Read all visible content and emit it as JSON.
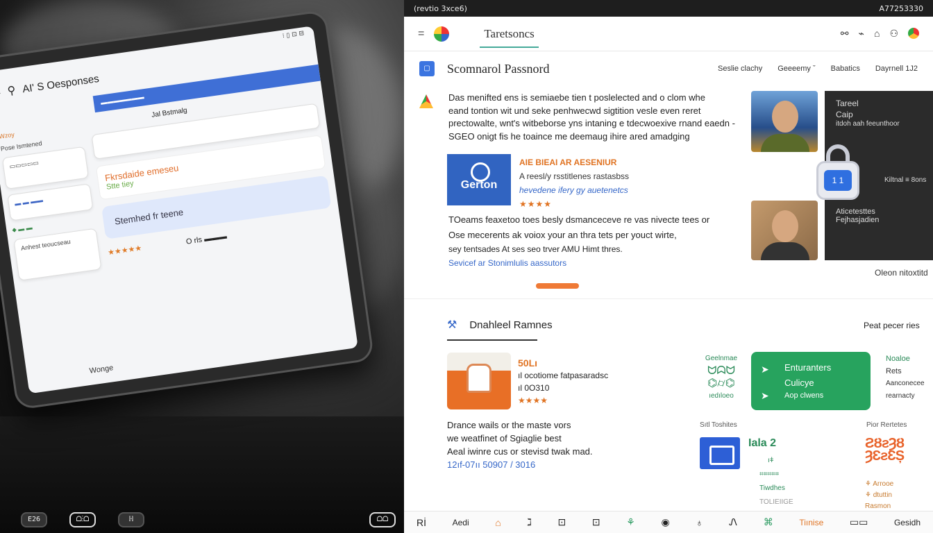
{
  "photo": {
    "tablet": {
      "status": "⁝ ▯ ⊡ ⊟",
      "header_icons": [
        "≡",
        "⚲"
      ],
      "title": "AI' S Oesponses",
      "blue_strip": "▬▬▬▬▬▬▬",
      "side": [
        "Wzoy",
        "Pose Ismtened",
        "▭▭▭▭▭",
        "▬ ▬ ▬▬",
        "⬥ ▬ ▬"
      ],
      "label_1": "Jal Bstmalg",
      "offer_title": "Fkrsdaide emeseu",
      "offer_sub": "Stte tiey",
      "bubble": "Stemhed fr teene",
      "rating": "★★★★★",
      "bottom_note": "O rls ▬▬▬",
      "foot": "Wonge",
      "small_card": "Anhest teoucseau"
    },
    "bottom_icons": [
      "E26",
      "ᗝ⁝ᗝ",
      "ℍ",
      "ᗝᗝ"
    ]
  },
  "browser": {
    "sysbar_left": "(revtio 3xce6)",
    "sysbar_right": "A77253330",
    "menu_icon": "=",
    "logo_icon": "app-logo",
    "app_title": "Taretsoncs",
    "tools": [
      "⚯",
      "⌁",
      "⌂",
      "⚇"
    ],
    "page_icon": "▢",
    "page_title": "Scomnarol Passnord",
    "filters": [
      "Seslie clachy",
      "Geeeemy ˇ",
      "Babatics",
      "Dayrnell 1J2"
    ],
    "section1": {
      "paragraph": [
        "Das menifted ens is semiaebe tien t poslelected and o clom whe",
        "eand tontion wit und seke penhwecwd sigtition vesle even reret",
        "prectowalte, wnt's witbeborse yns intaning e tdecwoexive rnand eaedn -",
        "SGEO onigt fis he toaince me deemaug ihire ared amadging"
      ],
      "brand": "Gerton",
      "promo_head": "AIE BIEAI AR AESENIUR",
      "promo_desc": "A reesl/y rsstitlenes rastasbss",
      "promo_link": "hevedene ifery gy auetenetcs",
      "promo_stars": "★★★★",
      "para2": [
        "TOeams feaxetoo toes besly dsmanceceve re vas nivecte tees or",
        "Ose mecerents ak voiox your an thra tets per youct wirte,",
        "sey tentsades At ses seo trver AMU Himt thres."
      ],
      "para2_link": "Sevicef ar Stonimlulis aassutors",
      "panel_title": "Tareel",
      "panel_sub": "Caip",
      "panel_line": "itdoh aah feeunthoor",
      "lock_text": "1 1",
      "panel_right": "Kiltnal ≡ 8ons",
      "panel_bottom": [
        "Aticetesttes",
        "Fejhasjadien"
      ],
      "more": "Oleon nitoxtitd"
    },
    "section2": {
      "title": "Dnahleel Ramnes",
      "title_icon": "⚒",
      "prev": "Peat pecer ries",
      "price": "50Lı",
      "desc": "ıl ocotiome fatpasaradsc",
      "code": "ıl 0O310",
      "stars": "★★★★",
      "para": [
        "Drance wails or the maste vors",
        "we weatfinet of Sgiaglie best",
        "Aeal iwinre cus or stevisd twak mad."
      ],
      "number": "12ıf-07ıı 50907 / 3016",
      "green_logo": [
        "Geelnmae",
        "ᗢᗣᗢ",
        "⌬⌭⌬",
        "ıedıloeo"
      ],
      "card_title": "Enturanters",
      "card_sub": "Culicye",
      "card_note": "Aop clwens",
      "right": [
        "Noaloe",
        "Rets",
        "Aanconecee",
        "rearnacty"
      ],
      "sl": "Sıtl Toshites",
      "stat": "Iala 2",
      "mini": [
        "ıǂ",
        "⌗⌗⌗⌗⌗",
        "Tiwdhes",
        "TOLIEIIGE"
      ],
      "pr": "Pior Rertetes",
      "orange_logo": [
        "ƧȢƨȜȢ",
        "ȜƐƨƐȘ"
      ],
      "ocol": [
        "⚘ Arrooe",
        "⚘ dtuttin",
        "Rasmon"
      ]
    },
    "bottombar": [
      "Rİ",
      "Aedi",
      "⌂",
      "ℷ",
      "⊡",
      "⊡",
      "⚘",
      "◉",
      "♁",
      "Ꮑ",
      "⌘",
      "Tiınise",
      "▭▭",
      "Gesidh"
    ]
  }
}
